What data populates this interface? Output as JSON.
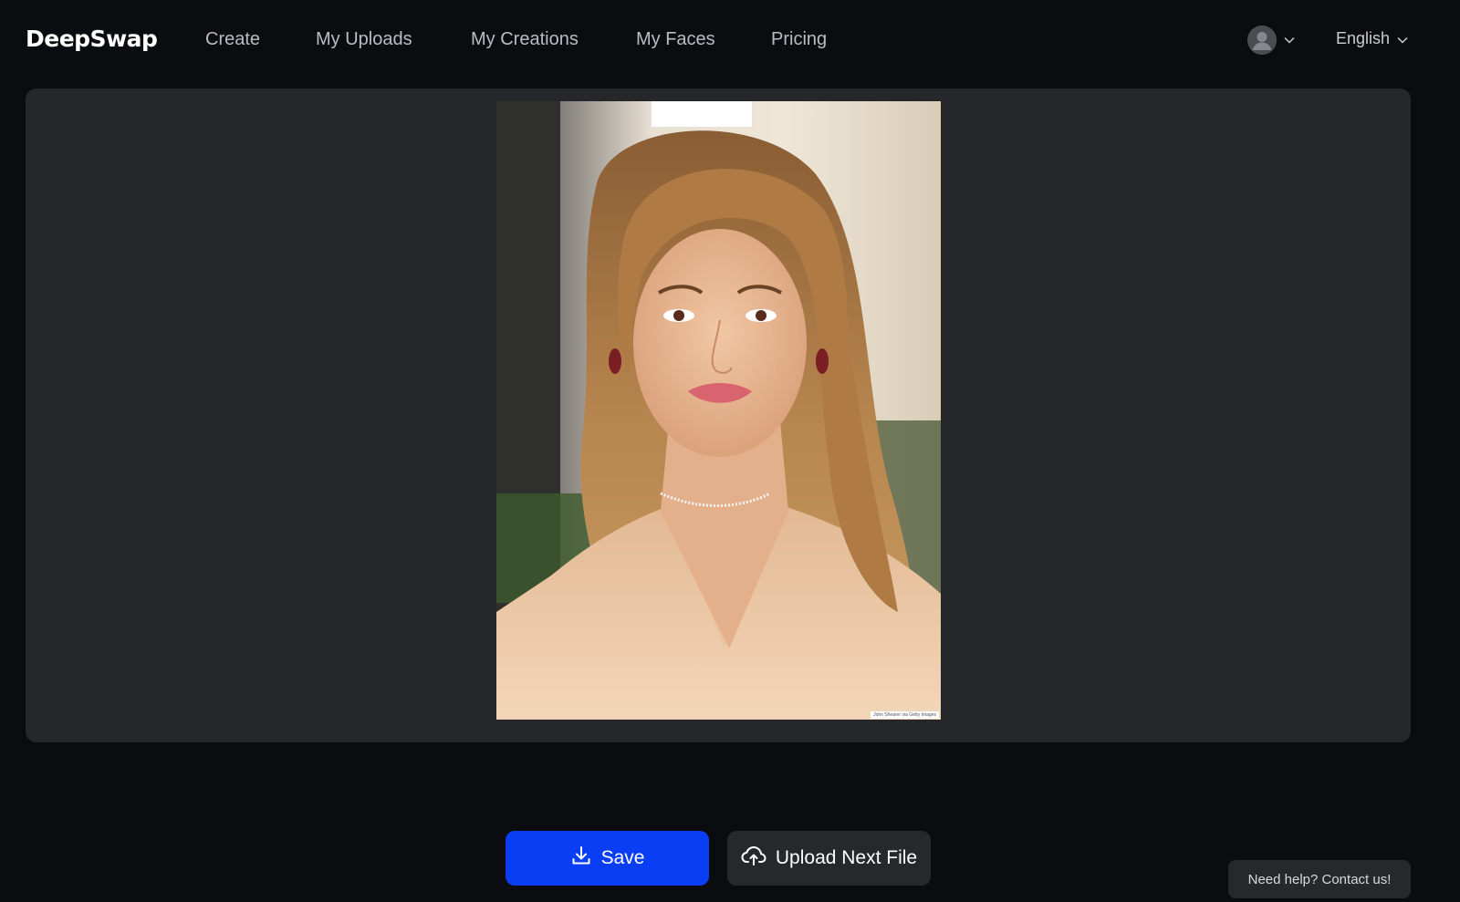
{
  "app": {
    "brand": "DeepSwap"
  },
  "nav": {
    "items": [
      {
        "label": "Create"
      },
      {
        "label": "My Uploads"
      },
      {
        "label": "My Creations"
      },
      {
        "label": "My Faces"
      },
      {
        "label": "Pricing"
      }
    ]
  },
  "header": {
    "account_icon": "user-avatar-icon",
    "language": "English"
  },
  "preview": {
    "image_credit": "John Shearer via Getty Images"
  },
  "actions": {
    "save_label": "Save",
    "save_icon": "download-icon",
    "upload_label": "Upload Next File",
    "upload_icon": "cloud-upload-icon"
  },
  "support": {
    "help_label": "Need help? Contact us!"
  },
  "colors": {
    "background": "#0b0c0f",
    "panel": "#25272a",
    "primary": "#0a3ef5",
    "secondary_button": "#26282c"
  }
}
